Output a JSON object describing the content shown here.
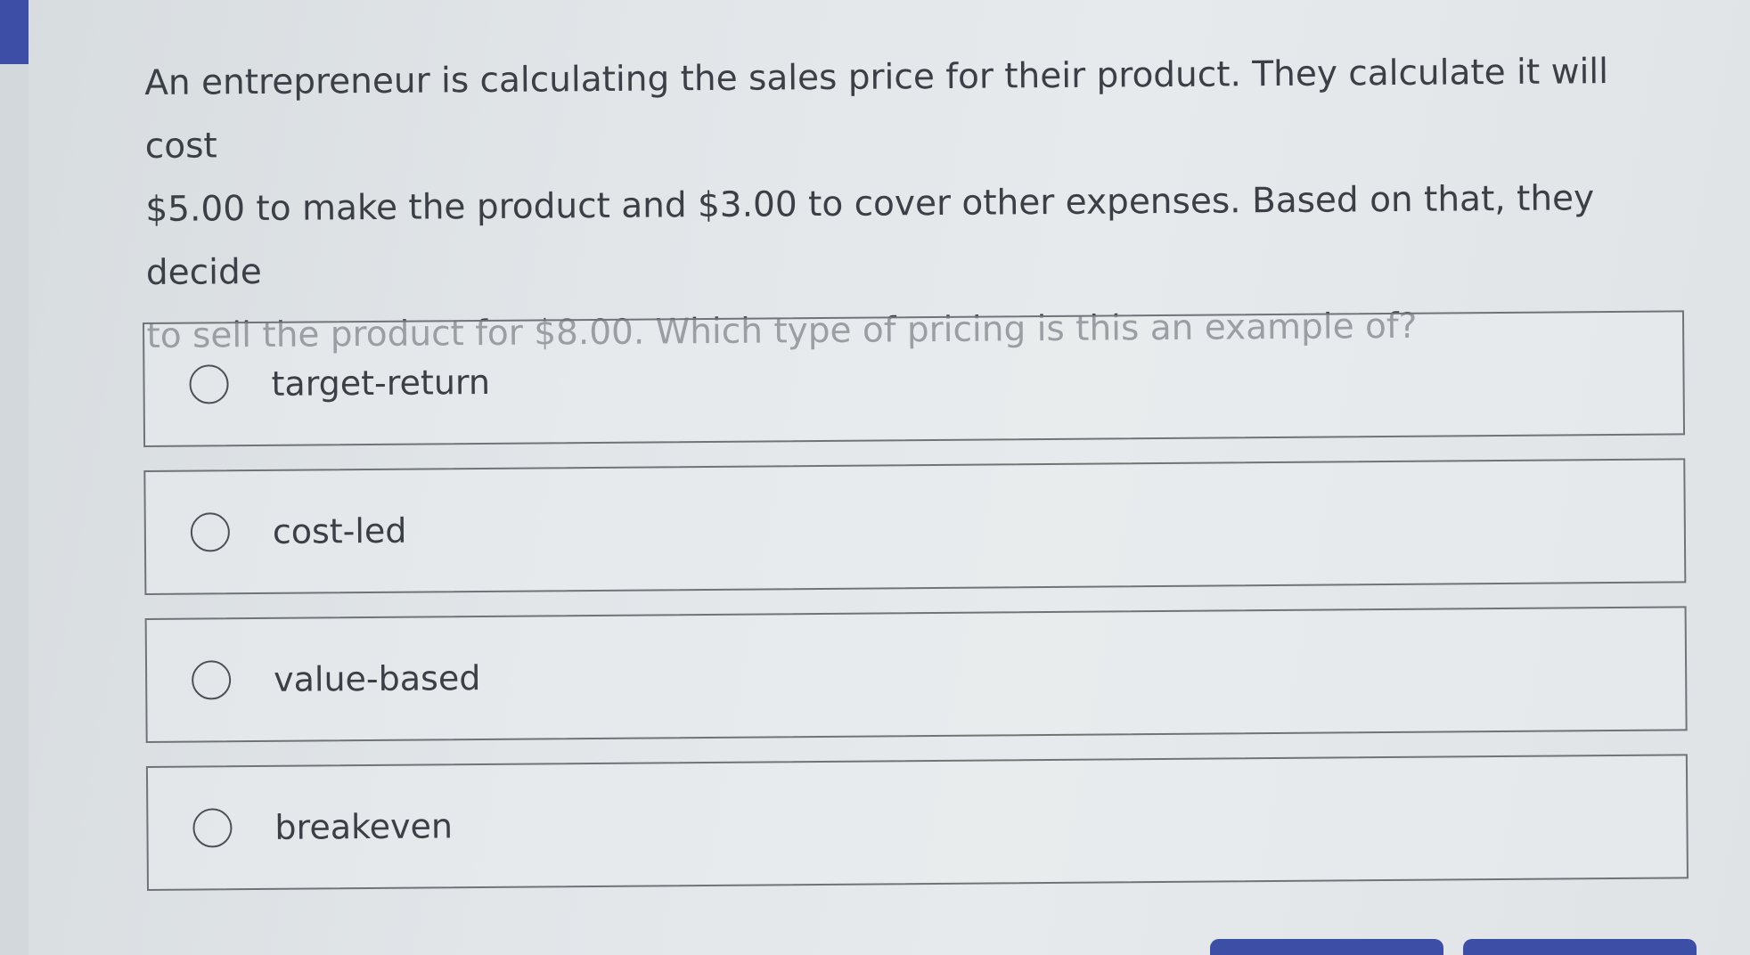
{
  "question": {
    "lines": [
      "An entrepreneur is calculating the sales price for their product. They calculate it will cost",
      "$5.00 to make the product and $3.00 to cover other expenses. Based on that, they decide",
      "to sell the product for $8.00. Which type of pricing is this an example of?"
    ]
  },
  "options": [
    {
      "label": "target-return"
    },
    {
      "label": "cost-led"
    },
    {
      "label": "value-based"
    },
    {
      "label": "breakeven"
    }
  ],
  "colors": {
    "accent": "#3d4ea6",
    "background": "#e2e6e9",
    "text": "#3b4047",
    "border": "#6f7479"
  }
}
